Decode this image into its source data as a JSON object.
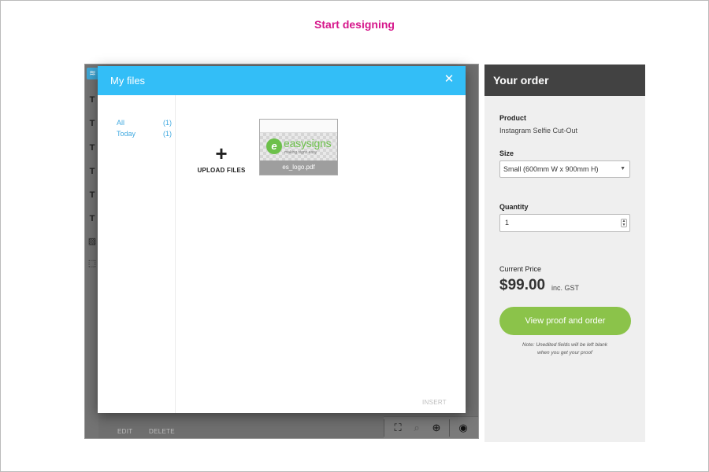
{
  "page": {
    "heading": "Start designing",
    "colors": {
      "heading": "#d6168b",
      "modal_header": "#33bef7",
      "order_header": "#424242",
      "primary_button": "#8bc34a",
      "link": "#3fa9e0"
    }
  },
  "designer": {
    "tools": [
      {
        "icon": "layers-icon",
        "glyph": "≋"
      },
      {
        "icon": "text-tool-icon",
        "glyph": "T"
      },
      {
        "icon": "text-tool-icon",
        "glyph": "T"
      },
      {
        "icon": "text-tool-icon",
        "glyph": "T"
      },
      {
        "icon": "text-tool-icon",
        "glyph": "T"
      },
      {
        "icon": "text-tool-icon",
        "glyph": "T"
      },
      {
        "icon": "text-tool-icon",
        "glyph": "T"
      },
      {
        "icon": "image-tool-icon",
        "glyph": "▨"
      },
      {
        "icon": "frame-tool-icon",
        "glyph": "⬚"
      }
    ],
    "bottom_toolbar": [
      {
        "icon": "fit-screen-icon",
        "glyph": "⛶"
      },
      {
        "icon": "zoom-out-icon",
        "glyph": "⌕"
      },
      {
        "icon": "zoom-in-icon",
        "glyph": "⊕"
      },
      {
        "icon": "eye-icon",
        "glyph": "◉"
      }
    ]
  },
  "modal": {
    "title": "My files",
    "close_glyph": "✕",
    "folders": [
      {
        "label": "All",
        "count": "(1)"
      },
      {
        "label": "Today",
        "count": "(1)"
      }
    ],
    "upload": {
      "plus": "+",
      "label": "UPLOAD FILES"
    },
    "files": [
      {
        "name": "es_logo.pdf",
        "logo_letter": "e",
        "logo_text": "easysigns",
        "logo_tagline": "making signs easy"
      }
    ],
    "actions": {
      "edit": "EDIT",
      "delete": "DELETE",
      "insert": "INSERT"
    }
  },
  "order": {
    "title": "Your order",
    "product_label": "Product",
    "product_value": "Instagram Selfie Cut-Out",
    "size_label": "Size",
    "size_value": "Small (600mm W x 900mm H)",
    "quantity_label": "Quantity",
    "quantity_value": "1",
    "price_label": "Current Price",
    "price": "$99.00",
    "price_suffix": "inc. GST",
    "cta": "View proof and order",
    "note_line1": "Note: Unedited fields will be left blank",
    "note_line2": "when you get your proof"
  }
}
